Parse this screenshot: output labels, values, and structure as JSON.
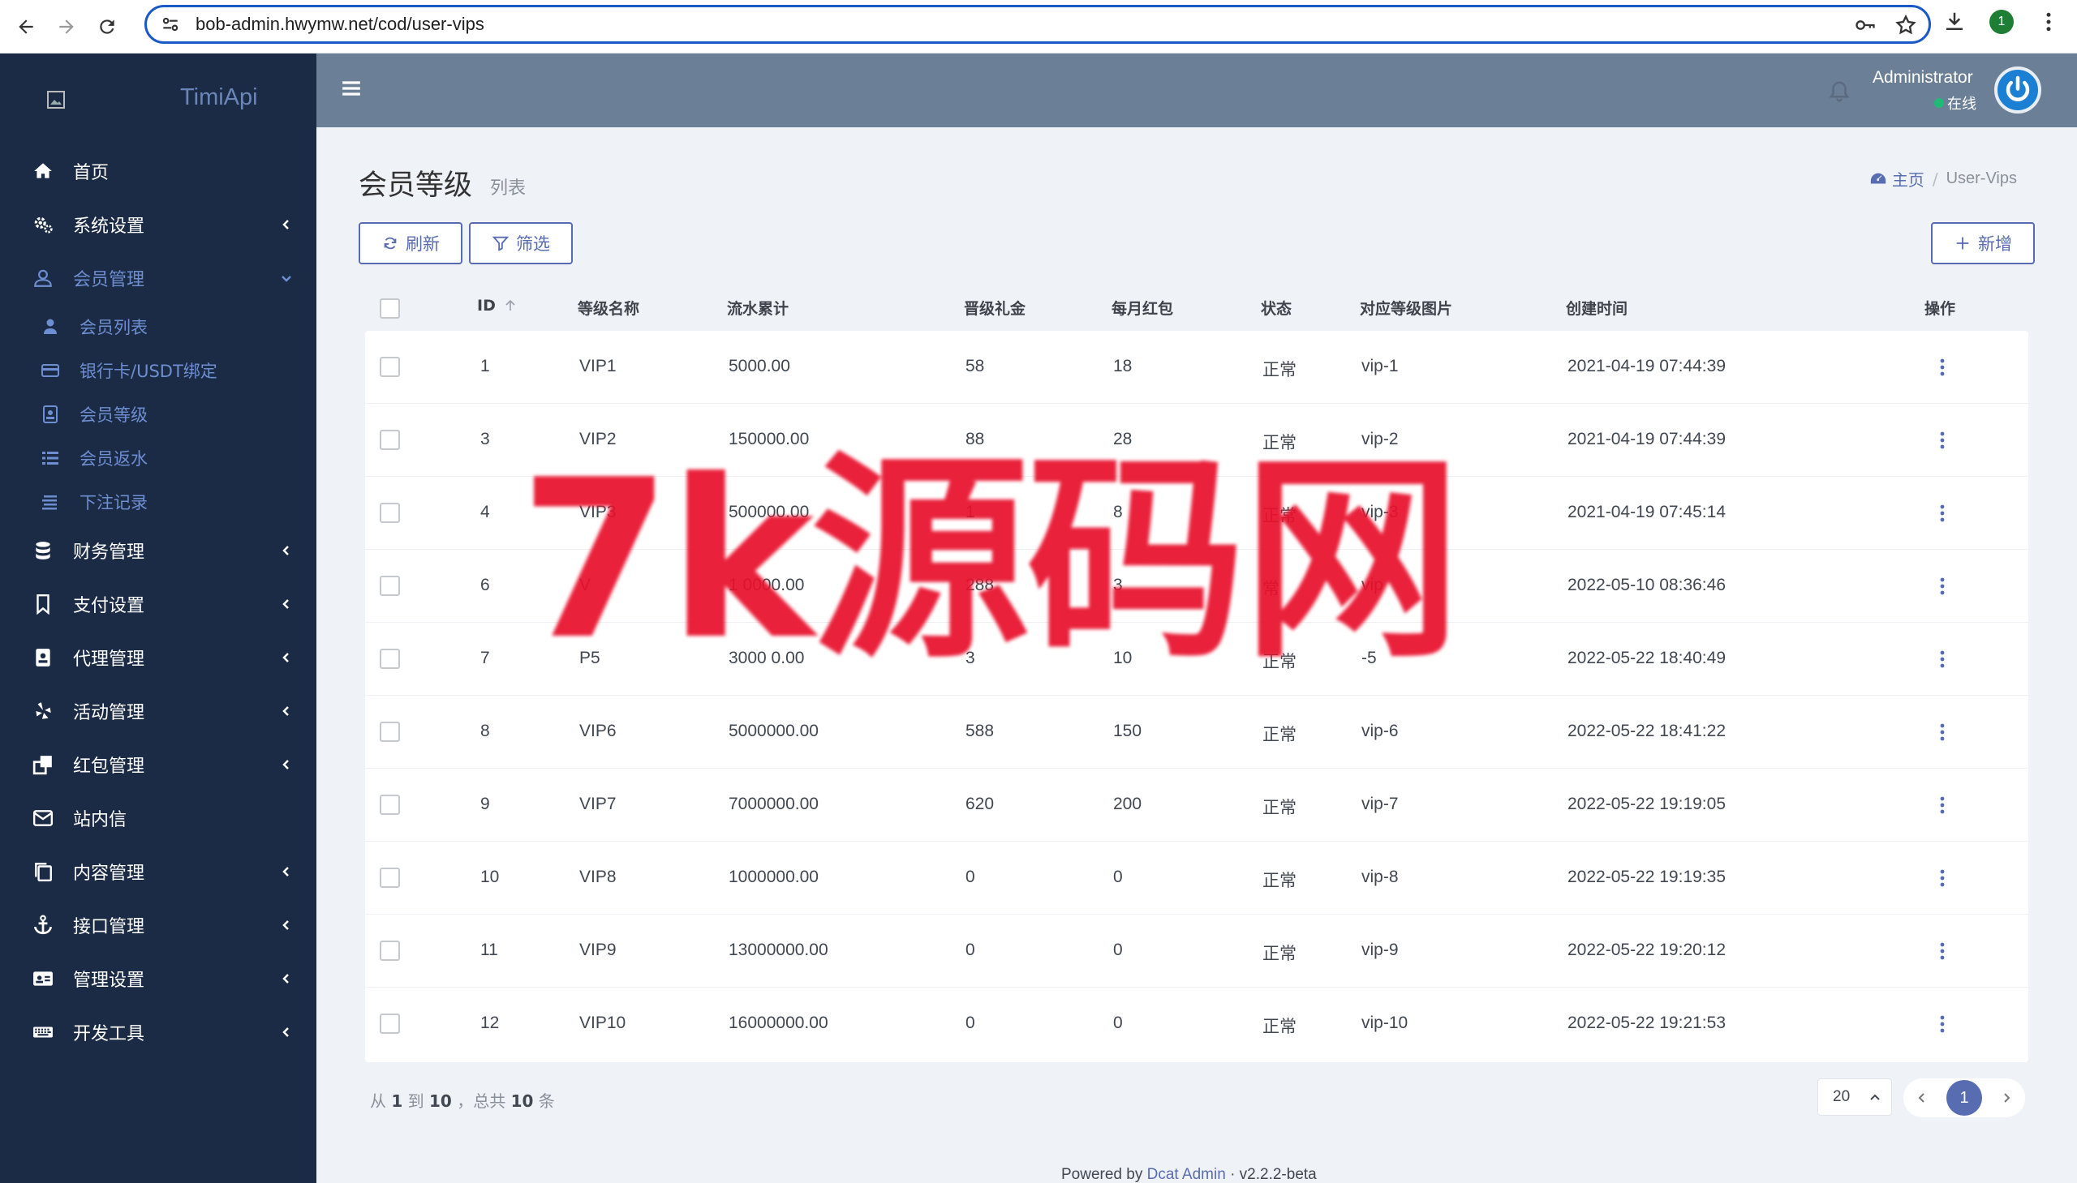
{
  "browser": {
    "url": "bob-admin.hwymw.net/cod/user-vips",
    "profile_initial": "1"
  },
  "sidebar": {
    "brand": "TimiApi",
    "items": [
      {
        "label": "首页",
        "icon": "home-icon",
        "chevron": false
      },
      {
        "label": "系统设置",
        "icon": "gears-icon",
        "chevron": true
      },
      {
        "label": "会员管理",
        "icon": "user-icon",
        "chevron": true,
        "expanded": true
      },
      {
        "label": "财务管理",
        "icon": "database-icon",
        "chevron": true
      },
      {
        "label": "支付设置",
        "icon": "bookmark-icon",
        "chevron": true
      },
      {
        "label": "代理管理",
        "icon": "id-badge-icon",
        "chevron": true
      },
      {
        "label": "活动管理",
        "icon": "yelp-icon",
        "chevron": true
      },
      {
        "label": "红包管理",
        "icon": "clone-icon",
        "chevron": true
      },
      {
        "label": "站内信",
        "icon": "envelope-icon",
        "chevron": false
      },
      {
        "label": "内容管理",
        "icon": "copy-icon",
        "chevron": true
      },
      {
        "label": "接口管理",
        "icon": "anchor-icon",
        "chevron": true
      },
      {
        "label": "管理设置",
        "icon": "address-card-icon",
        "chevron": true
      },
      {
        "label": "开发工具",
        "icon": "keyboard-icon",
        "chevron": true
      }
    ],
    "sub_items": [
      {
        "label": "会员列表",
        "icon": "user-icon"
      },
      {
        "label": "银行卡/USDT绑定",
        "icon": "credit-card-icon"
      },
      {
        "label": "会员等级",
        "icon": "id-card-icon"
      },
      {
        "label": "会员返水",
        "icon": "list-icon"
      },
      {
        "label": "下注记录",
        "icon": "list-lines-icon"
      }
    ]
  },
  "header": {
    "user_name": "Administrator",
    "status": "在线"
  },
  "page": {
    "title": "会员等级",
    "subtitle": "列表",
    "breadcrumb_home": "主页",
    "breadcrumb_current": "User-Vips"
  },
  "toolbar": {
    "refresh_label": "刷新",
    "filter_label": "筛选",
    "new_label": "新增"
  },
  "table": {
    "columns": [
      "ID",
      "等级名称",
      "流水累计",
      "晋级礼金",
      "每月红包",
      "状态",
      "对应等级图片",
      "创建时间",
      "操作"
    ],
    "rows": [
      {
        "id": "1",
        "name": "VIP1",
        "flow": "5000.00",
        "bonus": "58",
        "monthly": "18",
        "status": "正常",
        "image": "vip-1",
        "created": "2021-04-19 07:44:39"
      },
      {
        "id": "3",
        "name": "VIP2",
        "flow": "150000.00",
        "bonus": "88",
        "monthly": "28",
        "status": "正常",
        "image": "vip-2",
        "created": "2021-04-19 07:44:39"
      },
      {
        "id": "4",
        "name": "VIP3",
        "flow": "500000.00",
        "bonus": "1",
        "monthly": "8",
        "status": "正常",
        "image": "vip-3",
        "created": "2021-04-19 07:45:14"
      },
      {
        "id": "6",
        "name": "V",
        "flow": "1 0000.00",
        "bonus": "288",
        "monthly": "3",
        "status": "常",
        "image": "vip",
        "created": "2022-05-10 08:36:46"
      },
      {
        "id": "7",
        "name": "P5",
        "flow": "3000 0.00",
        "bonus": "3",
        "monthly": "10",
        "status": "正常",
        "image": "-5",
        "created": "2022-05-22 18:40:49"
      },
      {
        "id": "8",
        "name": "VIP6",
        "flow": "5000000.00",
        "bonus": "588",
        "monthly": "150",
        "status": "正常",
        "image": "vip-6",
        "created": "2022-05-22 18:41:22"
      },
      {
        "id": "9",
        "name": "VIP7",
        "flow": "7000000.00",
        "bonus": "620",
        "monthly": "200",
        "status": "正常",
        "image": "vip-7",
        "created": "2022-05-22 19:19:05"
      },
      {
        "id": "10",
        "name": "VIP8",
        "flow": "1000000.00",
        "bonus": "0",
        "monthly": "0",
        "status": "正常",
        "image": "vip-8",
        "created": "2022-05-22 19:19:35"
      },
      {
        "id": "11",
        "name": "VIP9",
        "flow": "13000000.00",
        "bonus": "0",
        "monthly": "0",
        "status": "正常",
        "image": "vip-9",
        "created": "2022-05-22 19:20:12"
      },
      {
        "id": "12",
        "name": "VIP10",
        "flow": "16000000.00",
        "bonus": "0",
        "monthly": "0",
        "status": "正常",
        "image": "vip-10",
        "created": "2022-05-22 19:21:53"
      }
    ]
  },
  "footer": {
    "from_label": "从",
    "from": "1",
    "to_label": "到",
    "to": "10",
    "total_label": "，总共",
    "total": "10",
    "unit": "条",
    "page_size": "20",
    "current_page": "1",
    "powered_prefix": "Powered by",
    "powered_link": "Dcat Admin",
    "version": "· v2.2.2-beta"
  },
  "watermark": "7k源码网",
  "colors": {
    "sidebar_bg": "#1c2b45",
    "topbar_bg": "#6b7f96",
    "accent": "#586cb1",
    "page_bg": "#eff3f8",
    "watermark": "#e8112d"
  }
}
